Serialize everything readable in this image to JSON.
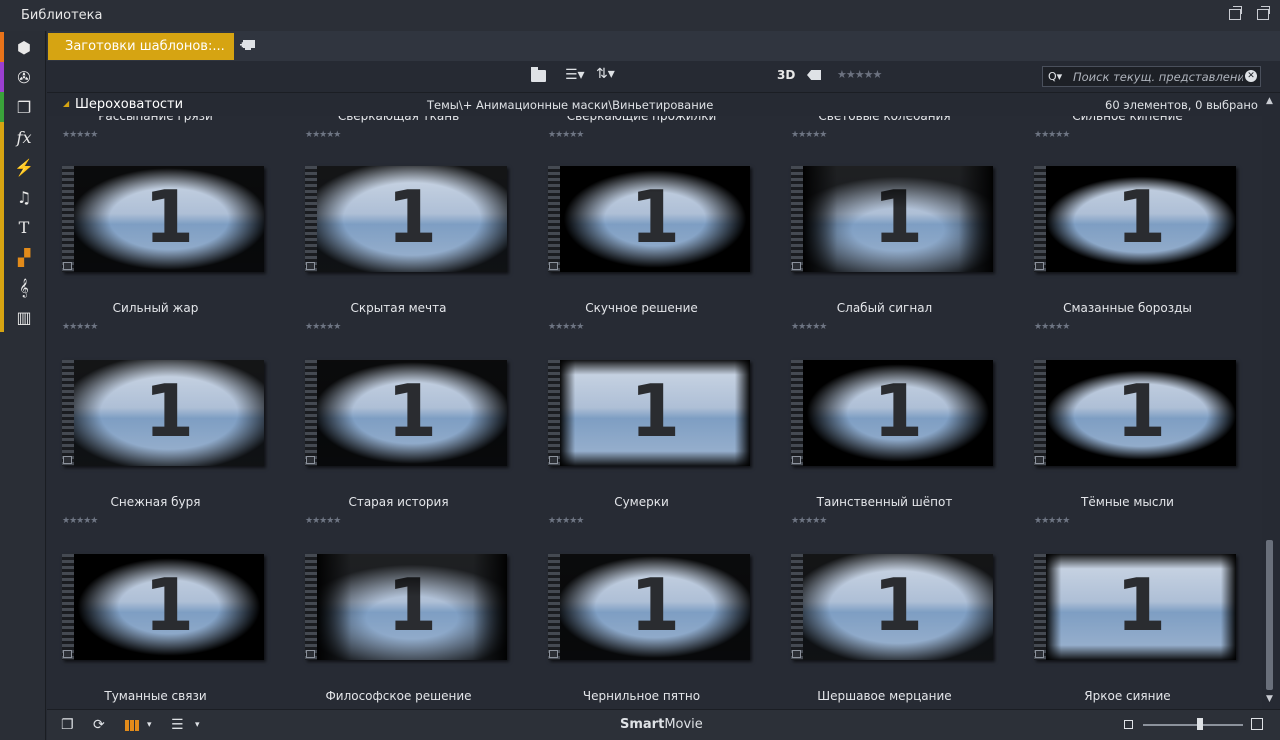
{
  "window": {
    "title": "Библиотека"
  },
  "sidebar": {
    "items": [
      {
        "icon": "box-icon",
        "color": "#e8731a",
        "glyph": "⬢"
      },
      {
        "icon": "film-reel-icon",
        "color": "#9b3fd0",
        "glyph": "✇"
      },
      {
        "icon": "layers-icon",
        "color": "#3aa23a",
        "glyph": "❐"
      },
      {
        "icon": "fx-icon",
        "color": "#d6a412",
        "glyph": "fx"
      },
      {
        "icon": "lightning-icon",
        "color": "#d6a412",
        "glyph": "⚡"
      },
      {
        "icon": "music-note-icon",
        "color": "#d6a412",
        "glyph": "♫"
      },
      {
        "icon": "text-icon",
        "color": "#d6a412",
        "glyph": "T"
      },
      {
        "icon": "template-icon",
        "color": "#d6a412",
        "glyph": "▞"
      },
      {
        "icon": "treble-clef-icon",
        "color": "#d6a412",
        "glyph": "𝄞"
      },
      {
        "icon": "piano-icon",
        "color": "#d6a412",
        "glyph": "▥"
      }
    ]
  },
  "tabs": {
    "active_label": "Заготовки шаблонов:..."
  },
  "toolbar": {
    "three_d": "3D",
    "rating_stars": "★★★★★",
    "search_placeholder": "Поиск текущ. представления"
  },
  "info": {
    "category": "Шероховатости",
    "path": "Темы\\+ Анимационные маски\\Виньетирование",
    "count": "60 элементов, 0 выбрано"
  },
  "grid": {
    "partial_top_labels": [
      "Рассыпание грязи",
      "Сверкающая ткань",
      "Сверкающие прожилки",
      "Световые колебания",
      "Сильное кипение"
    ],
    "items": [
      {
        "label": "Сильный жар",
        "number": "1"
      },
      {
        "label": "Скрытая мечта",
        "number": "1"
      },
      {
        "label": "Скучное решение",
        "number": "1"
      },
      {
        "label": "Слабый сигнал",
        "number": "1"
      },
      {
        "label": "Смазанные борозды",
        "number": "1"
      },
      {
        "label": "Снежная буря",
        "number": "1"
      },
      {
        "label": "Старая история",
        "number": "1"
      },
      {
        "label": "Сумерки",
        "number": "1"
      },
      {
        "label": "Таинственный шёпот",
        "number": "1"
      },
      {
        "label": "Тёмные мысли",
        "number": "1"
      },
      {
        "label": "Туманные связи",
        "number": "1"
      },
      {
        "label": "Философское решение",
        "number": "1"
      },
      {
        "label": "Чернильное пятно",
        "number": "1"
      },
      {
        "label": "Шершавое мерцание",
        "number": "1"
      },
      {
        "label": "Яркое сияние",
        "number": "1"
      }
    ],
    "star_rating": "★★★★★"
  },
  "bottombar": {
    "brand_bold": "Smart",
    "brand_rest": "Movie"
  }
}
